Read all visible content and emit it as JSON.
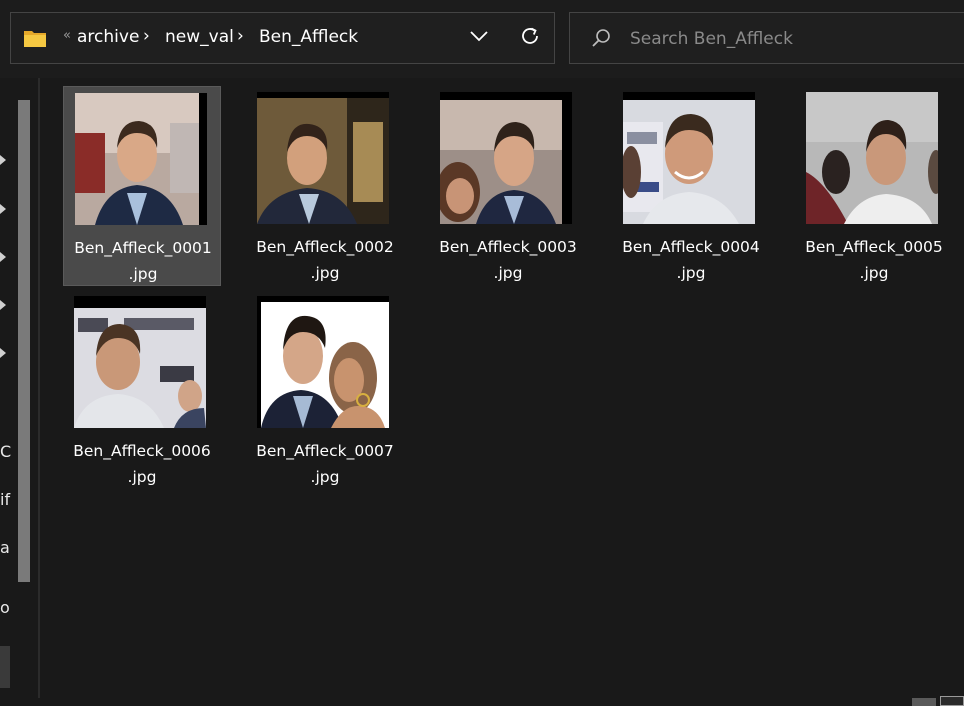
{
  "address_bar": {
    "overflow_glyph": "«",
    "crumbs": [
      "archive",
      "new_val",
      "Ben_Affleck"
    ],
    "separator": "›"
  },
  "search": {
    "placeholder": "Search Ben_Affleck"
  },
  "nav_pane": {
    "partial_labels": [
      "C",
      "if",
      "a",
      "o"
    ]
  },
  "files": [
    {
      "name_line1": "Ben_Affleck_0001",
      "name_line2": ".jpg",
      "selected": true
    },
    {
      "name_line1": "Ben_Affleck_0002",
      "name_line2": ".jpg",
      "selected": false
    },
    {
      "name_line1": "Ben_Affleck_0003",
      "name_line2": ".jpg",
      "selected": false
    },
    {
      "name_line1": "Ben_Affleck_0004",
      "name_line2": ".jpg",
      "selected": false
    },
    {
      "name_line1": "Ben_Affleck_0005",
      "name_line2": ".jpg",
      "selected": false
    },
    {
      "name_line1": "Ben_Affleck_0006",
      "name_line2": ".jpg",
      "selected": false
    },
    {
      "name_line1": "Ben_Affleck_0007",
      "name_line2": ".jpg",
      "selected": false
    }
  ],
  "icons": {
    "folder": "folder-icon",
    "dropdown": "chevron-down-icon",
    "refresh": "refresh-icon",
    "search": "search-icon"
  },
  "colors": {
    "background": "#191919",
    "selection": "#4a4a4a",
    "folder_yellow": "#f2c12e"
  }
}
